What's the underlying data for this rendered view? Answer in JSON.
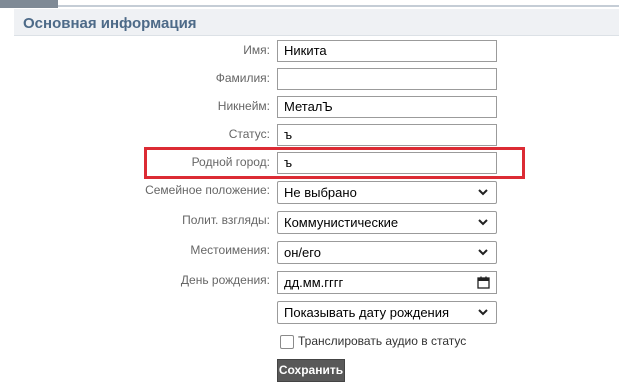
{
  "section": {
    "title": "Основная информация"
  },
  "fields": {
    "first_name": {
      "label": "Имя:",
      "value": "Никита"
    },
    "last_name": {
      "label": "Фамилия:",
      "value": ""
    },
    "nickname": {
      "label": "Никнейм:",
      "value": "МеталЪ"
    },
    "status": {
      "label": "Статус:",
      "value": "ъ"
    },
    "hometown": {
      "label": "Родной город:",
      "value": "ъ"
    },
    "relationship": {
      "label": "Семейное положение:",
      "value": "Не выбрано"
    },
    "political_views": {
      "label": "Полит. взгляды:",
      "value": "Коммунистические"
    },
    "pronouns": {
      "label": "Местоимения:",
      "value": "он/его"
    },
    "birthday": {
      "label": "День рождения:",
      "value": "дд.мм.гггг"
    },
    "birthday_visibility": {
      "value": "Показывать дату рождения"
    }
  },
  "broadcast_audio": {
    "label": "Транслировать аудио в статус",
    "checked": false
  },
  "save_button": {
    "label": "Сохранить"
  },
  "colors": {
    "accent": "#4d6a88",
    "highlight": "#dc2b34",
    "button": "#595959"
  },
  "icons": {
    "select": "chevron-down-icon",
    "date": "calendar-icon"
  }
}
